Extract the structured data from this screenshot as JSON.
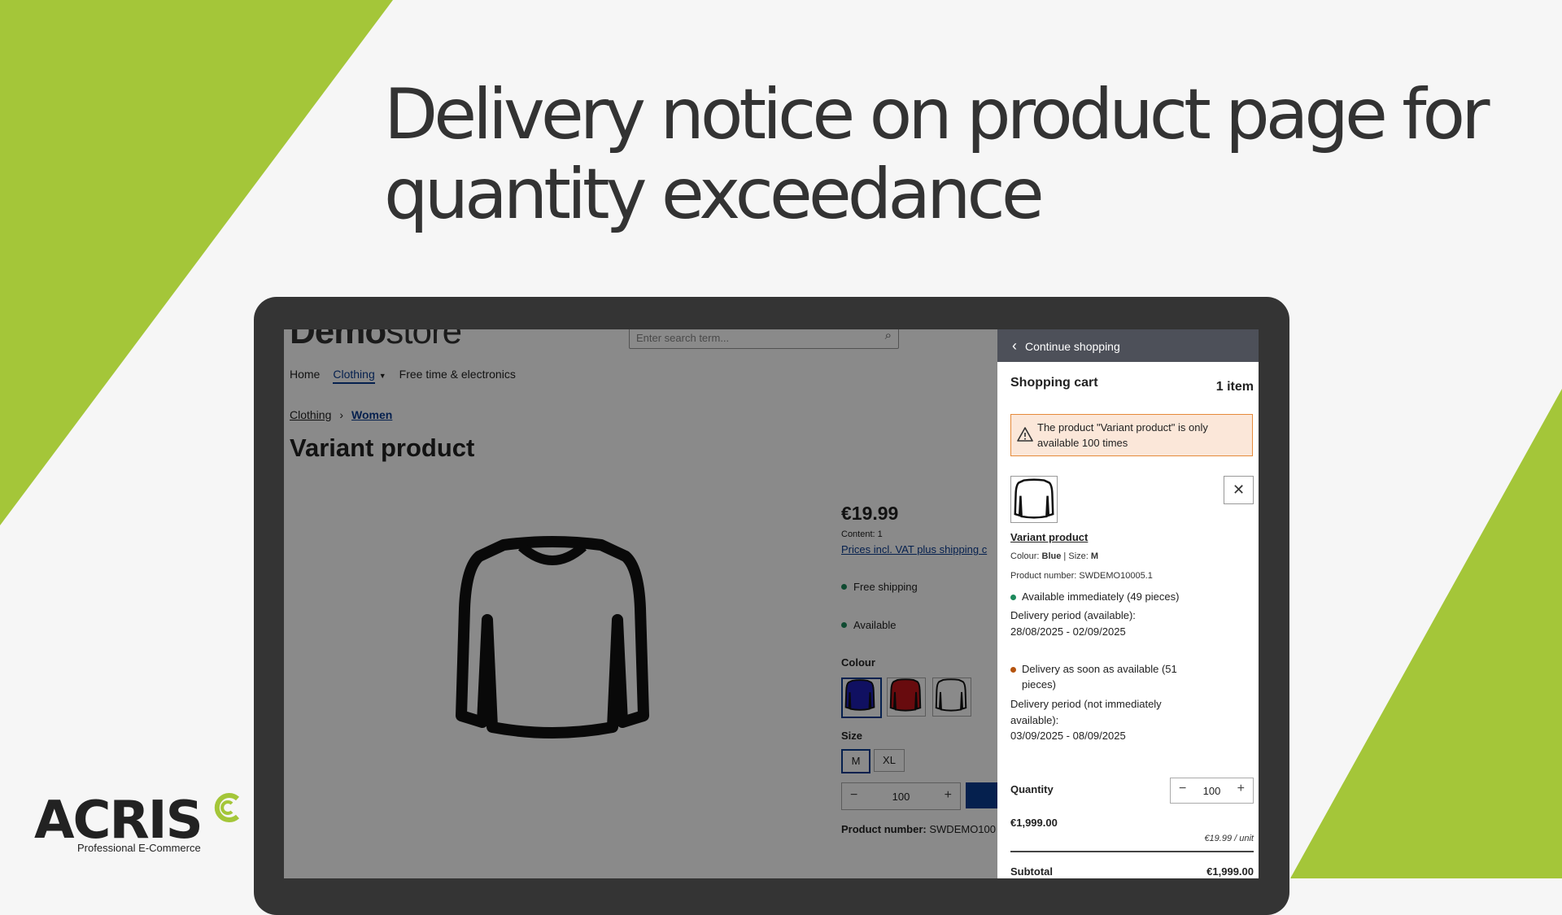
{
  "headline": {
    "line1": "Delivery notice on product page for",
    "line2": "quantity exceedance"
  },
  "colors": {
    "background": "#f6f6f6",
    "brand_green": "#a4c639",
    "frame": "#343434",
    "accent_blue": "#0b3c91",
    "cart_header": "#4d5059",
    "alert_bg": "#fbe7d9",
    "alert_border": "#e58a3a",
    "available_green": "#1d8a5c",
    "delayed_orange": "#b5540f"
  },
  "shop": {
    "logo_bold": "Demo",
    "logo_light": "store",
    "search_placeholder": "Enter search term...",
    "nav": [
      "Home",
      "Clothing",
      "Free time & electronics"
    ],
    "breadcrumb": [
      "Clothing",
      "Women"
    ],
    "product_title": "Variant product",
    "price": "€19.99",
    "content": "Content: 1",
    "vat_note": "Prices incl. VAT plus shipping c",
    "features": [
      "Free shipping",
      "Available"
    ],
    "colour_label": "Colour",
    "size_label": "Size",
    "sizes": [
      "M",
      "XL"
    ],
    "quantity": "100",
    "product_number_label": "Product number:",
    "product_number": "SWDEMO100"
  },
  "cart": {
    "back_label": "Continue shopping",
    "title": "Shopping cart",
    "count": "1 item",
    "alert": "The product \"Variant product\" is only available 100 times",
    "item": {
      "name": "Variant product",
      "colour_label": "Colour:",
      "colour_value": "Blue",
      "size_label": "Size:",
      "size_value": "M",
      "product_number": "Product number: SWDEMO10005.1",
      "stock_available": "Available immediately (49 pieces)",
      "delivery_available_label": "Delivery period (available):",
      "delivery_available_dates": "28/08/2025 - 02/09/2025",
      "stock_later": "Delivery as soon as available (51 pieces)",
      "delivery_later_label": "Delivery period (not immediately available):",
      "delivery_later_dates": "03/09/2025 - 08/09/2025",
      "quantity_label": "Quantity",
      "quantity": "100",
      "line_total": "€1,999.00",
      "unit_price": "€19.99 / unit"
    },
    "subtotal_label": "Subtotal",
    "subtotal": "€1,999.00"
  },
  "brand": {
    "name": "ACRIS",
    "tagline": "Professional E-Commerce"
  },
  "icons": [
    "back-chevron-icon",
    "warning-icon",
    "close-icon",
    "search-icon",
    "caret-down-icon",
    "minus-icon",
    "plus-icon",
    "sweater-icon"
  ]
}
